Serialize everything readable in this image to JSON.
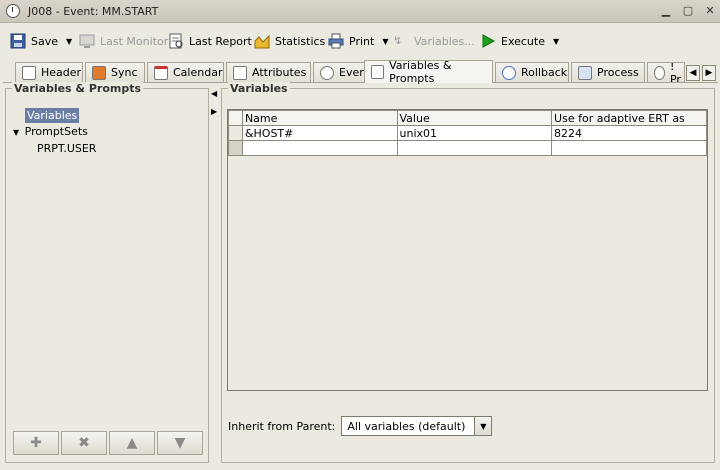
{
  "window": {
    "title": "J008 - Event: MM.START",
    "controls": [
      "minimize-icon",
      "maximize-icon",
      "close-icon"
    ]
  },
  "toolbar": {
    "save": "Save",
    "last_monitor": "Last Monitor",
    "last_report": "Last Report",
    "statistics": "Statistics",
    "print": "Print",
    "variables": "Variables...",
    "execute": "Execute"
  },
  "tabs": [
    "Header",
    "Sync",
    "Calendar",
    "Attributes",
    "Event",
    "Variables & Prompts",
    "Rollback",
    "Process",
    "! Pr"
  ],
  "active_tab": "Variables & Prompts",
  "left_panel": {
    "title": "Variables & Prompts",
    "tree": {
      "variables": "Variables",
      "promptsets": "PromptSets",
      "prpt_user": "PRPT.USER"
    }
  },
  "right_panel": {
    "title": "Variables",
    "columns": [
      "Name",
      "Value",
      "Use for adaptive ERT as"
    ],
    "rows": [
      [
        "&HOST#",
        "unix01",
        "8224"
      ],
      [
        "",
        "",
        ""
      ]
    ],
    "inherit_label": "Inherit from Parent:",
    "inherit_value": "All variables (default)"
  },
  "colors": {
    "selection": "#6b7fa6",
    "execute_icon": "#1ea11e",
    "window_bg": "#ece9e1"
  }
}
